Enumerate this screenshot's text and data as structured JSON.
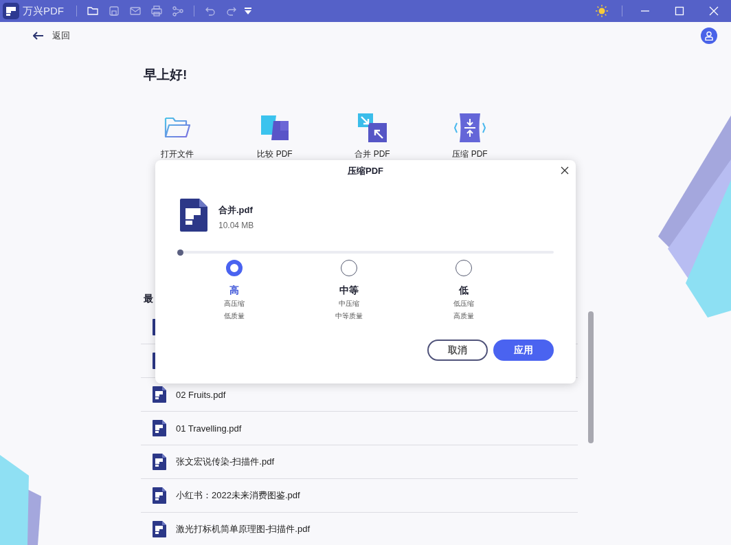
{
  "titlebar": {
    "app_name": "万兴PDF"
  },
  "back": {
    "label": "返回"
  },
  "greeting": "早上好!",
  "tools": [
    {
      "label": "打开文件",
      "kind": "open"
    },
    {
      "label": "比较 PDF",
      "kind": "compare"
    },
    {
      "label": "合并 PDF",
      "kind": "merge"
    },
    {
      "label": "压缩 PDF",
      "kind": "compress"
    }
  ],
  "recent": {
    "heading": "最",
    "files": [
      {
        "kind": "covered"
      },
      {
        "kind": "covered"
      },
      {
        "kind": "file",
        "name": "02 Fruits.pdf"
      },
      {
        "kind": "file",
        "name": "01 Travelling.pdf"
      },
      {
        "kind": "file",
        "name": "张文宏说传染-扫描件.pdf"
      },
      {
        "kind": "file",
        "name": "小红书：2022未来消费图鉴.pdf"
      },
      {
        "kind": "file",
        "name": "激光打标机简单原理图-扫描件.pdf"
      }
    ]
  },
  "dialog": {
    "title": "压缩PDF",
    "file_name": "合并.pdf",
    "file_size": "10.04 MB",
    "slider": {
      "level": 0
    },
    "options": [
      {
        "label": "高",
        "lines": [
          "高压缩",
          "低质量"
        ],
        "selected": true
      },
      {
        "label": "中等",
        "lines": [
          "中压缩",
          "中等质量"
        ],
        "selected": false
      },
      {
        "label": "低",
        "lines": [
          "低压缩",
          "高质量"
        ],
        "selected": false
      }
    ],
    "buttons": [
      {
        "label": "取消",
        "kind": "secondary"
      },
      {
        "label": "应用",
        "kind": "primary"
      }
    ]
  }
}
